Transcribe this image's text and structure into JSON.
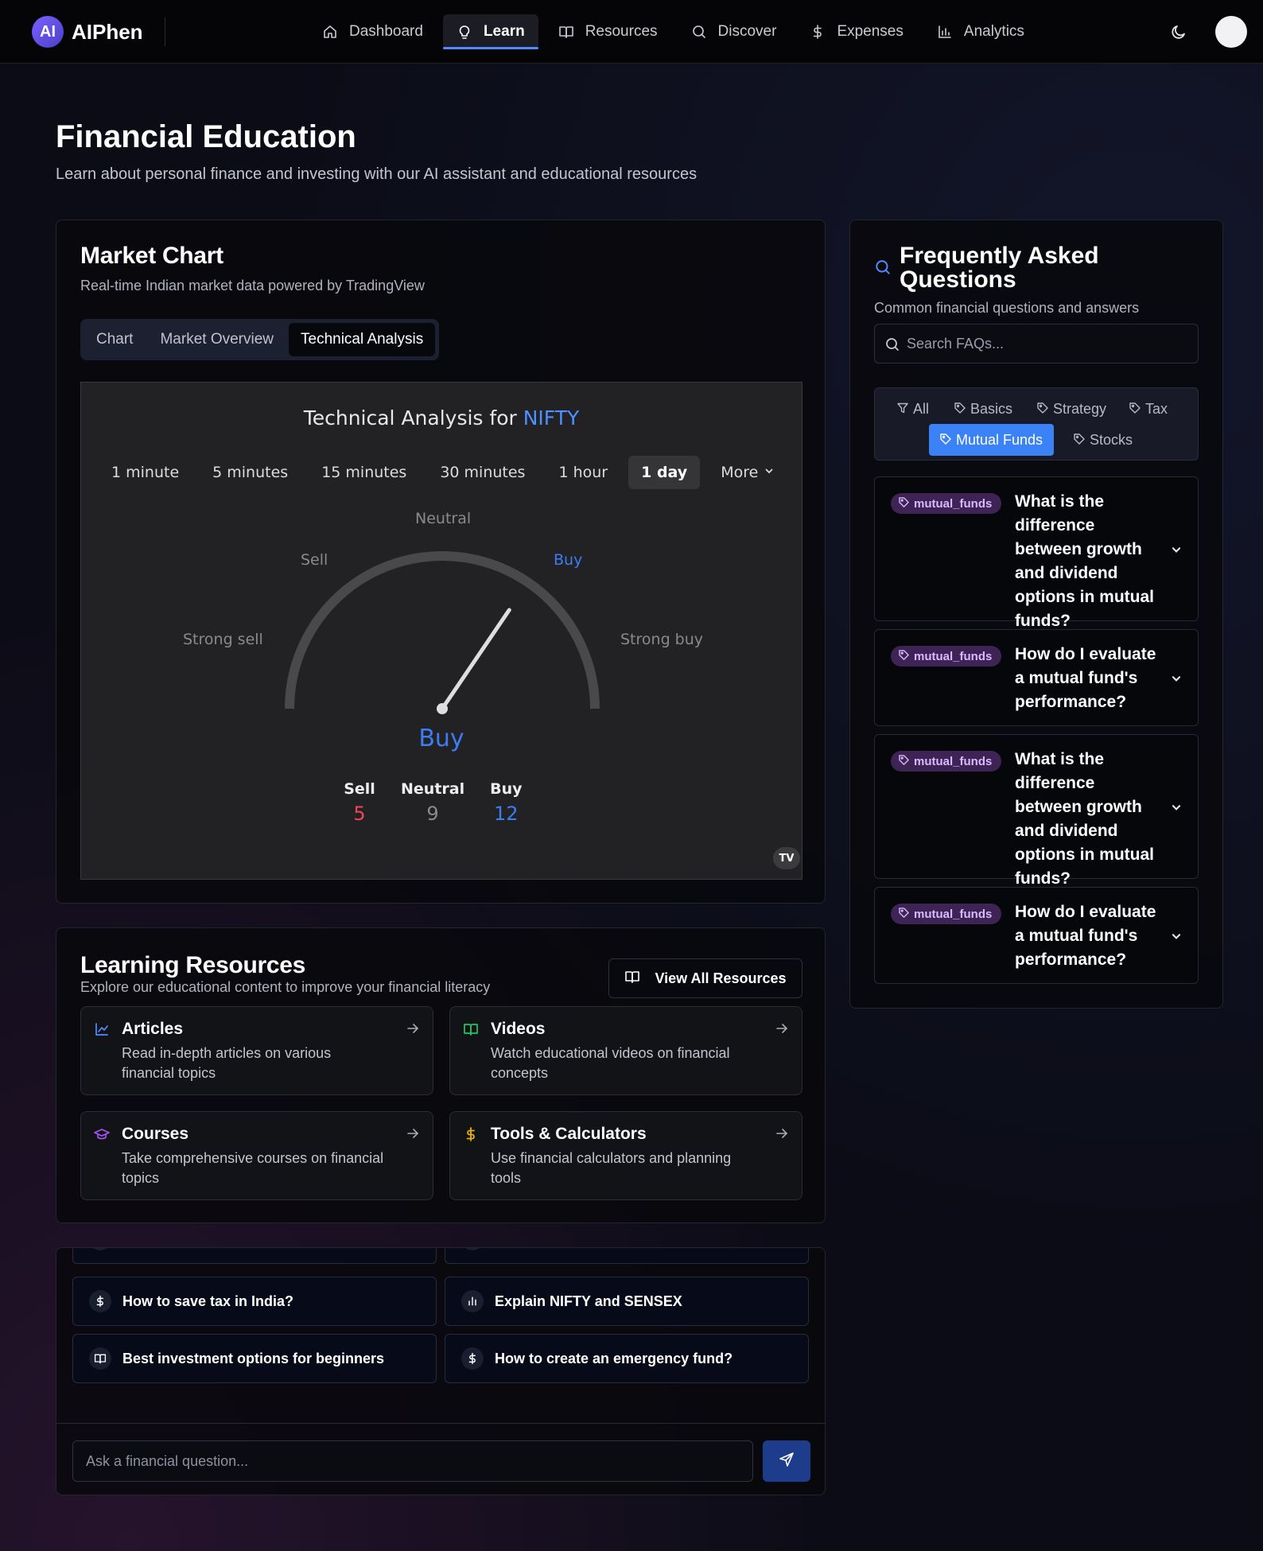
{
  "brand": {
    "logo_text": "AI",
    "name": "AIPhen"
  },
  "nav": {
    "items": [
      {
        "label": "Dashboard",
        "icon": "home-icon"
      },
      {
        "label": "Learn",
        "icon": "lightbulb-icon",
        "active": true
      },
      {
        "label": "Resources",
        "icon": "book-icon"
      },
      {
        "label": "Discover",
        "icon": "search-icon"
      },
      {
        "label": "Expenses",
        "icon": "dollar-icon"
      },
      {
        "label": "Analytics",
        "icon": "bar-chart-icon"
      }
    ],
    "theme_toggle_icon": "moon-icon"
  },
  "page": {
    "title": "Financial Education",
    "subtitle": "Learn about personal finance and investing with our AI assistant and educational resources"
  },
  "market": {
    "title": "Market Chart",
    "description": "Real-time Indian market data powered by TradingView",
    "tabs": [
      "Chart",
      "Market Overview",
      "Technical Analysis"
    ],
    "active_tab": "Technical Analysis",
    "widget": {
      "title_prefix": "Technical Analysis for",
      "symbol": "NIFTY",
      "intervals": [
        "1 minute",
        "5 minutes",
        "15 minutes",
        "30 minutes",
        "1 hour",
        "1 day"
      ],
      "active_interval": "1 day",
      "more_label": "More",
      "gauge_labels": {
        "strong_sell": "Strong sell",
        "sell": "Sell",
        "neutral": "Neutral",
        "buy": "Buy",
        "strong_buy": "Strong buy"
      },
      "gauge_value": 0.69,
      "verdict": "Buy",
      "counts": {
        "sell_label": "Sell",
        "sell": "5",
        "neutral_label": "Neutral",
        "neutral": "9",
        "buy_label": "Buy",
        "buy": "12"
      },
      "logo_text": "TV",
      "colors": {
        "buy": "#3d7cf2",
        "sell": "#f0455a",
        "neutral": "#8b8b8f"
      }
    }
  },
  "learning": {
    "title": "Learning Resources",
    "description": "Explore our educational content to improve your financial literacy",
    "view_all_label": "View All Resources",
    "resources": [
      {
        "title": "Articles",
        "description": "Read in-depth articles on various financial topics",
        "icon": "line-chart-icon",
        "color": "#4f8cff"
      },
      {
        "title": "Videos",
        "description": "Watch educational videos on financial concepts",
        "icon": "book-open-icon",
        "color": "#22c55e"
      },
      {
        "title": "Courses",
        "description": "Take comprehensive courses on financial topics",
        "icon": "graduation-cap-icon",
        "color": "#a855f7"
      },
      {
        "title": "Tools & Calculators",
        "description": "Use financial calculators and planning tools",
        "icon": "dollar-icon",
        "color": "#eab308"
      }
    ]
  },
  "assistant": {
    "suggestions": [
      {
        "text": "How to save tax in India?",
        "icon": "dollar-icon"
      },
      {
        "text": "Explain NIFTY and SENSEX",
        "icon": "bar-chart-icon"
      },
      {
        "text": "Best investment options for beginners",
        "icon": "book-open-icon"
      },
      {
        "text": "How to create an emergency fund?",
        "icon": "dollar-icon"
      }
    ],
    "input_placeholder": "Ask a financial question...",
    "send_icon": "send-icon"
  },
  "faq": {
    "title": "Frequently Asked Questions",
    "description": "Common financial questions and answers",
    "search_placeholder": "Search FAQs...",
    "filters": [
      "All",
      "Basics",
      "Strategy",
      "Tax",
      "Mutual Funds",
      "Stocks"
    ],
    "active_filter": "Mutual Funds",
    "items": [
      {
        "tag": "mutual_funds",
        "question": "What is the difference between growth and dividend options in mutual funds?"
      },
      {
        "tag": "mutual_funds",
        "question": "How do I evaluate a mutual fund's performance?"
      },
      {
        "tag": "mutual_funds",
        "question": "What is the difference between growth and dividend options in mutual funds?"
      },
      {
        "tag": "mutual_funds",
        "question": "How do I evaluate a mutual fund's performance?"
      }
    ]
  }
}
